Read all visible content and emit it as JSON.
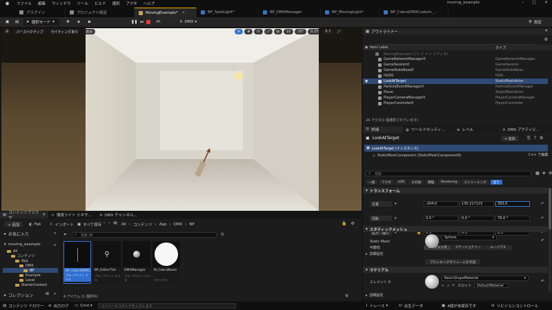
{
  "menu": {
    "items": [
      "ファイル",
      "編集",
      "ウィンドウ",
      "ツール",
      "ビルド",
      "選択",
      "アクタ",
      "ヘルプ"
    ],
    "project_title": "moving_example",
    "window_controls": [
      "–",
      "□",
      "✕"
    ]
  },
  "tabs": [
    {
      "label": "プラグイン",
      "active": false
    },
    {
      "label": "プロジェクト設定",
      "active": false
    },
    {
      "label": "MovingExample*",
      "active": true
    },
    {
      "label": "BP_SpotLight*",
      "active": false
    },
    {
      "label": "BP_DMXManager",
      "active": false
    },
    {
      "label": "BP_MovingLight*",
      "active": false
    },
    {
      "label": "BP_CobraDMXCustom_...",
      "active": false
    }
  ],
  "toolbar": {
    "select_mode": "選択モード",
    "dmx": "DMX",
    "settings": "設定"
  },
  "viewport": {
    "perspective": "パースペクティブ",
    "lighting": "ライティングあり",
    "show": "表示",
    "angle": "10°",
    "scale": "0.25",
    "speed": "0.7",
    "grid": "10"
  },
  "outliner": {
    "title": "アウトライナー",
    "search_placeholder": "検索",
    "col_label": "Item Label",
    "col_type": "タイプ",
    "rows": [
      {
        "name": "MovingExample (プレイ イン エディタ)",
        "type": "",
        "selected": false,
        "dim": true
      },
      {
        "name": "GameNetworkManager0",
        "type": "GameNetworkManager",
        "selected": false,
        "dim": false
      },
      {
        "name": "GameSession0",
        "type": "GameSession",
        "selected": false,
        "dim": false
      },
      {
        "name": "GameStateBase0",
        "type": "GameStateBase",
        "selected": false,
        "dim": false
      },
      {
        "name": "HUD0",
        "type": "HUD",
        "selected": false,
        "dim": false
      },
      {
        "name": "LookAtTarget",
        "type": "StaticMeshActor",
        "selected": true,
        "dim": false
      },
      {
        "name": "ParticleEventManager0",
        "type": "ParticleEventManager",
        "selected": false,
        "dim": false
      },
      {
        "name": "Plane",
        "type": "StaticMeshActor",
        "selected": false,
        "dim": false
      },
      {
        "name": "PlayerCameraManager0",
        "type": "PlayerCameraManager",
        "selected": false,
        "dim": false
      },
      {
        "name": "PlayerController0",
        "type": "PlayerController",
        "selected": false,
        "dim": false
      }
    ],
    "status": "24 アクタ(1 個選択されています)"
  },
  "details": {
    "tabs": [
      "詳細",
      "ワールドセッティ...",
      "レベル",
      "DMX アクティビ..."
    ],
    "actor_name": "LookAtTarget",
    "add_label": "+ 追加",
    "instance_label": "LookAtTarget (インスタンス)",
    "component_label": "StaticMeshComponent (StaticMeshComponent0)",
    "edit_cpp": "C++ で編集",
    "search_placeholder": "検索",
    "filters": [
      "一般",
      "アクタ",
      "LOD",
      "その他",
      "物理",
      "Rendering",
      "ストリーミング",
      "全て"
    ],
    "transform_header": "トランスフォーム",
    "location_label": "位置",
    "rotation_label": "回転",
    "scale_label": "拡大・縮小",
    "location": [
      "-204.0",
      "135.217123",
      "393.0"
    ],
    "rotation": [
      "0.0 °",
      "0.0 °",
      "78.0 °"
    ],
    "scale": [
      "0.3",
      "0.3",
      "0.3"
    ],
    "mobility_label": "可動性",
    "mobility": [
      "スタティック",
      "ステーショナリー",
      "ムーバブル"
    ],
    "static_mesh_header": "スタティックメッシュ",
    "static_mesh_label": "Static Mesh",
    "static_mesh_value": "Sphere",
    "advanced_label": "詳細設定",
    "blocking_volume": "ブロッキングボリュームを作成",
    "materials_header": "マテリアル",
    "element_label": "エレメント 0",
    "material_value": "BasicShapeMaterial",
    "slot_label": "スロット",
    "slot_value": "DefaultMaterial"
  },
  "content_browser": {
    "tabs": [
      "コンテンツブラウザ",
      "環境ライト ミキサ...",
      "DMX チャンネル..."
    ],
    "add": "+ 追加",
    "fab": "Fab",
    "import": "インポート",
    "save_all": "すべて保存",
    "path": [
      "All",
      "コンテンツ",
      "App",
      "DMX",
      "BP"
    ],
    "search_placeholder": "検索 BP",
    "favorites": "お気に入り",
    "project": "moving_example",
    "tree": [
      {
        "label": "All",
        "depth": 0
      },
      {
        "label": "コンテンツ",
        "depth": 1
      },
      {
        "label": "App",
        "depth": 2
      },
      {
        "label": "DMX",
        "depth": 3
      },
      {
        "label": "BP",
        "depth": 4
      },
      {
        "label": "Example",
        "depth": 3
      },
      {
        "label": "Level",
        "depth": 3
      },
      {
        "label": "StarterContent",
        "depth": 2
      }
    ],
    "collections": "コレクション",
    "assets": [
      {
        "name": "BP_CobraDMXCustom_Extend",
        "type": "ブループリント クラス",
        "selected": true
      },
      {
        "name": "BP_EditorTick",
        "type": "ブループリント クラス",
        "selected": false
      },
      {
        "name": "DMXManager",
        "type": "ブループリント クラス",
        "selected": false
      },
      {
        "name": "M_CobraBeam",
        "type": "マテリアル",
        "selected": false
      }
    ],
    "status": "4 アイテム (1 選択中)"
  },
  "statusbar": {
    "drawer": "コンテンツ ドロワー",
    "output_log": "出力ログ",
    "cmd": "Cmd",
    "cmd_placeholder": "コンソールコマンドを入力します",
    "trace": "トレース",
    "derived": "派生データ",
    "unsaved": "4個が未保存です",
    "source_control": "リビジョンコントロール"
  }
}
